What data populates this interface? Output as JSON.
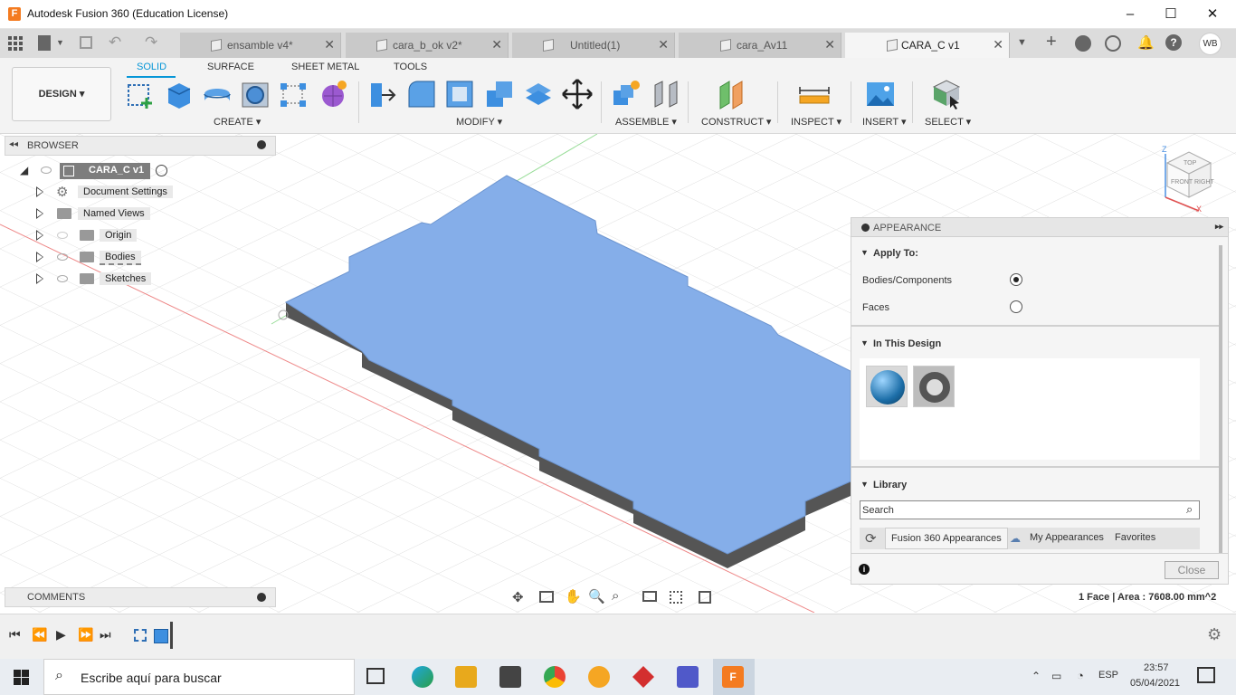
{
  "window": {
    "title": "Autodesk Fusion 360 (Education License)",
    "logo": "F",
    "user": "WB"
  },
  "tabs": [
    {
      "label": "ensamble v4*"
    },
    {
      "label": "cara_b_ok v2*"
    },
    {
      "label": "Untitled(1)"
    },
    {
      "label": "cara_Av11"
    },
    {
      "label": "CARA_C v1"
    }
  ],
  "toolbar": {
    "design": "DESIGN",
    "workspace_tabs": [
      "SOLID",
      "SURFACE",
      "SHEET METAL",
      "TOOLS"
    ],
    "groups": [
      "CREATE",
      "MODIFY",
      "ASSEMBLE",
      "CONSTRUCT",
      "INSPECT",
      "INSERT",
      "SELECT"
    ]
  },
  "browser": {
    "title": "BROWSER",
    "root": "CARA_C v1",
    "items": [
      {
        "label": "Document Settings"
      },
      {
        "label": "Named Views"
      },
      {
        "label": "Origin"
      },
      {
        "label": "Bodies"
      },
      {
        "label": "Sketches"
      }
    ]
  },
  "viewcube": {
    "top": "TOP",
    "front": "FRONT",
    "right": "RIGHT",
    "z": "Z",
    "x": "X"
  },
  "appearance": {
    "title": "APPEARANCE",
    "apply_to": "Apply To:",
    "bodies": "Bodies/Components",
    "faces": "Faces",
    "in_design": "In This Design",
    "library": "Library",
    "search_value": "Search",
    "tab_fusion": "Fusion 360 Appearances",
    "tab_my": "My Appearances",
    "tab_fav": "Favorites",
    "close": "Close"
  },
  "comments": {
    "title": "COMMENTS"
  },
  "status": {
    "selection": "1 Face | Area : 7608.00 mm^2"
  },
  "taskbar": {
    "search_placeholder": "Escribe aquí para buscar",
    "lang": "ESP",
    "time": "23:57",
    "date": "05/04/2021"
  },
  "colors": {
    "accent": "#0696d7",
    "body_fill": "#85aee9",
    "body_side": "#555555"
  }
}
